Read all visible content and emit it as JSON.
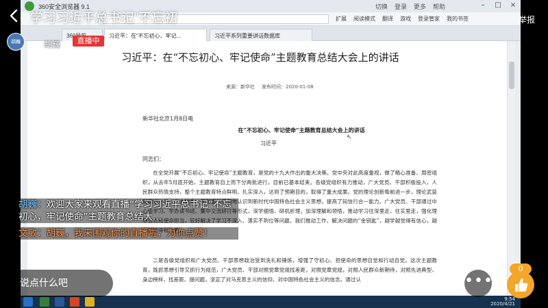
{
  "browser": {
    "brand": "360安全浏览器 9.1",
    "top_actions": [
      "切换",
      "登录",
      "更多",
      "帮助"
    ],
    "toolbar_tools": [
      "扩展",
      "阅读模式",
      "翻译",
      "游戏",
      "登录管家",
      "我的书签"
    ],
    "tabs": [
      {
        "label": "360导航"
      },
      {
        "label": "习近平：在“不忘初心、牢记..."
      },
      {
        "label": "习近平系列重要讲话数据库"
      }
    ],
    "taskbar_clock": {
      "time": "9:54",
      "date": "2020/4/21"
    }
  },
  "document": {
    "title": "习近平：在“不忘初心、牢记使命”主题教育总结大会上的讲话",
    "source_label": "来源：新华社",
    "date_label": "发布时间：2020-01-08",
    "dateline": "新华社北京1月8日电",
    "subtitle": "在“不忘初心、牢记使命”主题教育总结大会上的讲话",
    "author": "习近平",
    "greeting": "同志们：",
    "para1": "在全党开展“不忘初心、牢记使命”主题教育，是党的十九大作出的重大决策。党中央对此高度重视，做了精心准备、周密组织，从去年5月底开始，主题教育自上而下分两批进行，目前已基本结束。各级党组织有力推动，广大党员、干部积极投入，人民群众热情支持，整个主题教育特点鲜明、扎实深入，达到了预期目的，取得了重大成果。党的理论创新每前进一步，理论武装就跟进一步，广大党员、干部更加深刻地认识到新时代中国特色社会主义思想，提高了知信行合一能力。广大党员、干部通过中心组学习、学办读书班、集中交流研讨等形式，深学细悟、研机析理，加深理解和领悟，推动学习往深里走、往实里走，强化理想信念和使命担当，较好解决了学习不深入、落实不到位等问题。我们推动工作、解决问题的“金钥匙”，越学越觉得有信心，越学越觉得有力量。",
    "para2": "二是各级党组织和广大党员、干部思想政治受到洗礼和锤炼，增强了守初心、担使命的思想自觉和行动自觉。这次主题教育，既抓思想引导又抓行为规范，广大党员、干部对照党章党规找差距，对照党章党规，对照人民群众新期待，对照先进典型、身边榜样，找差距、提问题，坚定了对马克思主义的信仰、对中国特色社会主义的信念。通过认"
  },
  "stream": {
    "title": "学习习近平总书记“不忘初",
    "report_label": "举报",
    "host_name": "胡巍",
    "host_avatar_text": "胡巍",
    "live_badge": "直播中",
    "chat": [
      {
        "user": "胡巍：",
        "text": "欢迎大家来观看直播“学习习近平总书记“不忘初心，牢记使命”主题教育总结大..."
      },
      {
        "user": "文敏：",
        "text": "胡巍，我来围观你的直播啦，为你点赞！"
      }
    ],
    "comment_placeholder": "说点什么吧",
    "like_count": "0"
  },
  "colors": {
    "live_red": "#e73434",
    "like_orange": "#f5a528",
    "chat_name_blue": "#7cc7ff",
    "chat_alt_orange": "#ff9e5a"
  }
}
